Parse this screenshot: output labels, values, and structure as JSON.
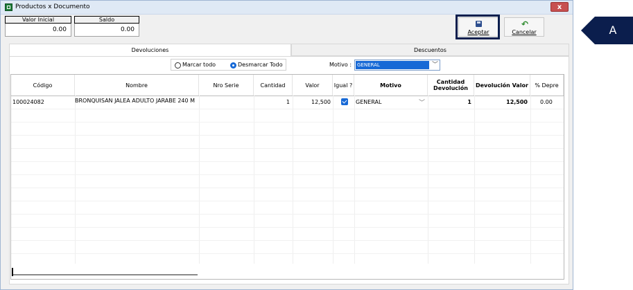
{
  "window": {
    "title": "Productos x Documento",
    "close_label": "x"
  },
  "summary": {
    "valor_inicial": {
      "label": "Valor Inicial",
      "value": "0.00"
    },
    "saldo": {
      "label": "Saldo",
      "value": "0.00"
    }
  },
  "toolbar": {
    "aceptar_label": "Aceptar",
    "cancelar_label": "Cancelar"
  },
  "tabs": [
    {
      "label": "Devoluciones"
    },
    {
      "label": "Descuentos"
    }
  ],
  "filters": {
    "marcar_todo": "Marcar todo",
    "desmarcar_todo": "Desmarcar Todo",
    "motivo_label": "Motivo :",
    "motivo_value": "GENERAL"
  },
  "grid": {
    "columns": [
      "Código",
      "Nombre",
      "Nro Serie",
      "Cantidad",
      "Valor",
      "Igual ?",
      "Motivo",
      "Cantidad Devolución",
      "Devolución Valor",
      "% Depre"
    ],
    "rows": [
      {
        "codigo": "100024082",
        "nombre": "BRONQUISAN JALEA ADULTO JARABE 240 M",
        "nro_serie": "",
        "cantidad": "1",
        "valor": "12,500",
        "igual": true,
        "motivo": "GENERAL",
        "cantidad_devolucion": "1",
        "devolucion_valor": "12,500",
        "depre": "0.00"
      }
    ]
  },
  "annotation": {
    "label": "A"
  },
  "colors": {
    "accent": "#1769d6",
    "marker": "#0b1e4d",
    "title_bg": "#dfe9f5"
  }
}
